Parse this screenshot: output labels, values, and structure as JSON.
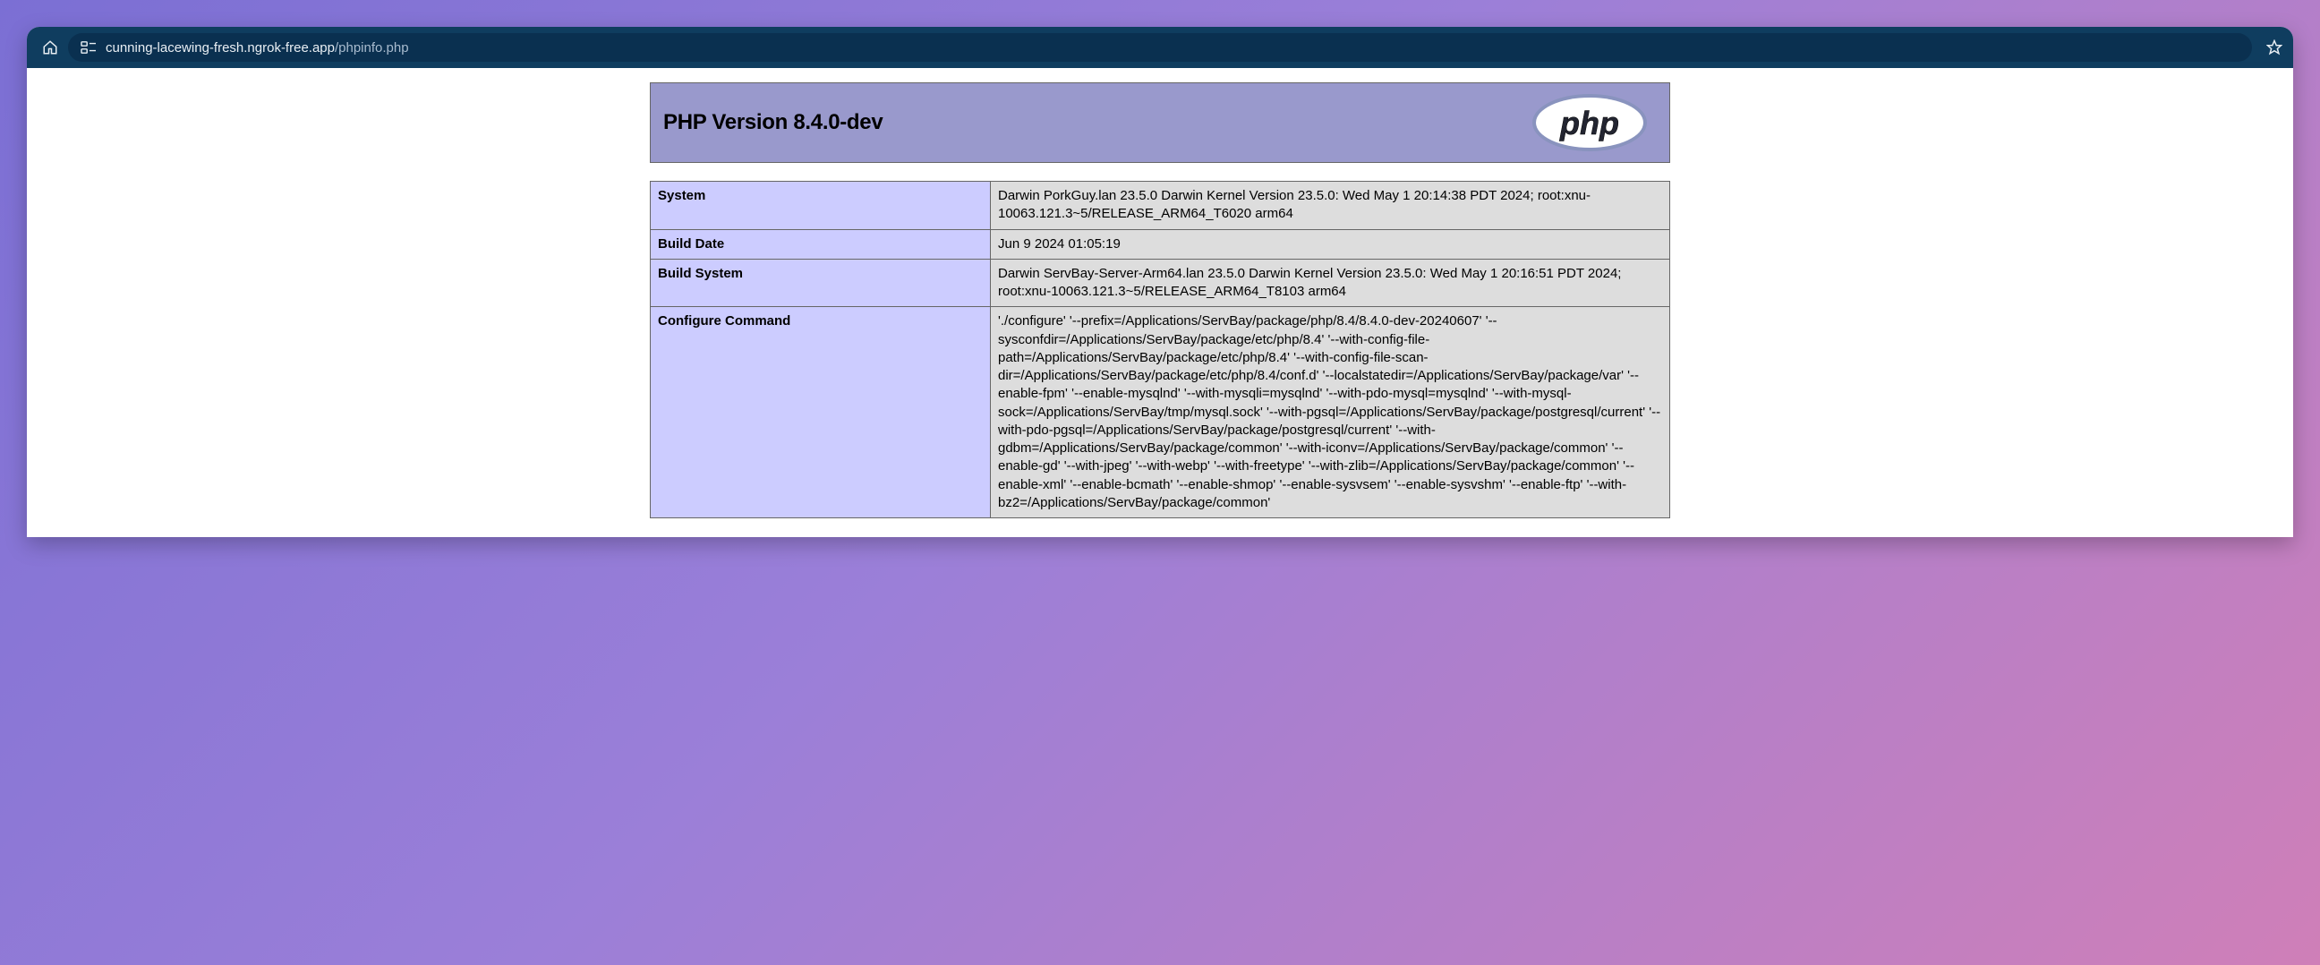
{
  "browser": {
    "url_domain": "cunning-lacewing-fresh.ngrok-free.app",
    "url_path": "/phpinfo.php"
  },
  "phpinfo": {
    "title": "PHP Version 8.4.0-dev",
    "logo_text": "php",
    "rows": [
      {
        "label": "System",
        "value": "Darwin PorkGuy.lan 23.5.0 Darwin Kernel Version 23.5.0: Wed May 1 20:14:38 PDT 2024; root:xnu-10063.121.3~5/RELEASE_ARM64_T6020 arm64"
      },
      {
        "label": "Build Date",
        "value": "Jun 9 2024 01:05:19"
      },
      {
        "label": "Build System",
        "value": "Darwin ServBay-Server-Arm64.lan 23.5.0 Darwin Kernel Version 23.5.0: Wed May 1 20:16:51 PDT 2024; root:xnu-10063.121.3~5/RELEASE_ARM64_T8103 arm64"
      },
      {
        "label": "Configure Command",
        "value": "'./configure' '--prefix=/Applications/ServBay/package/php/8.4/8.4.0-dev-20240607' '--sysconfdir=/Applications/ServBay/package/etc/php/8.4' '--with-config-file-path=/Applications/ServBay/package/etc/php/8.4' '--with-config-file-scan-dir=/Applications/ServBay/package/etc/php/8.4/conf.d' '--localstatedir=/Applications/ServBay/package/var' '--enable-fpm' '--enable-mysqlnd' '--with-mysqli=mysqlnd' '--with-pdo-mysql=mysqlnd' '--with-mysql-sock=/Applications/ServBay/tmp/mysql.sock' '--with-pgsql=/Applications/ServBay/package/postgresql/current' '--with-pdo-pgsql=/Applications/ServBay/package/postgresql/current' '--with-gdbm=/Applications/ServBay/package/common' '--with-iconv=/Applications/ServBay/package/common' '--enable-gd' '--with-jpeg' '--with-webp' '--with-freetype' '--with-zlib=/Applications/ServBay/package/common' '--enable-xml' '--enable-bcmath' '--enable-shmop' '--enable-sysvsem' '--enable-sysvshm' '--enable-ftp' '--with-bz2=/Applications/ServBay/package/common'"
      }
    ]
  }
}
